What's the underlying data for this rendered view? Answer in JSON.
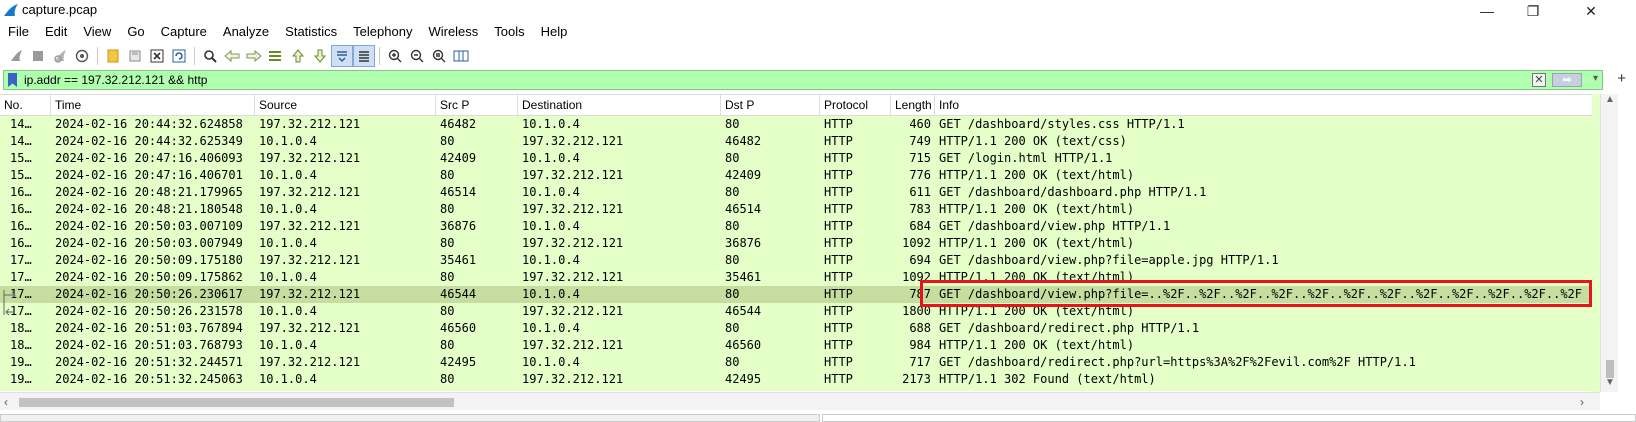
{
  "window": {
    "title": "capture.pcap",
    "min": "—",
    "restore": "❐",
    "close": "✕"
  },
  "menu": [
    "File",
    "Edit",
    "View",
    "Go",
    "Capture",
    "Analyze",
    "Statistics",
    "Telephony",
    "Wireless",
    "Tools",
    "Help"
  ],
  "filter": {
    "value": "ip.addr == 197.32.212.121 && http",
    "clear": "✕",
    "apply": "➡",
    "dropdown": "▾",
    "add": "+"
  },
  "columns": [
    "No.",
    "Time",
    "Source",
    "Src P",
    "Destination",
    "Dst P",
    "Protocol",
    "Length",
    "Info"
  ],
  "packets": [
    {
      "no": "14…",
      "time": "2024-02-16 20:44:32.624858",
      "src": "197.32.212.121",
      "sport": "46482",
      "dst": "10.1.0.4",
      "dport": "80",
      "proto": "HTTP",
      "len": "460",
      "info": "GET /dashboard/styles.css HTTP/1.1"
    },
    {
      "no": "14…",
      "time": "2024-02-16 20:44:32.625349",
      "src": "10.1.0.4",
      "sport": "80",
      "dst": "197.32.212.121",
      "dport": "46482",
      "proto": "HTTP",
      "len": "749",
      "info": "HTTP/1.1 200 OK  (text/css)"
    },
    {
      "no": "15…",
      "time": "2024-02-16 20:47:16.406093",
      "src": "197.32.212.121",
      "sport": "42409",
      "dst": "10.1.0.4",
      "dport": "80",
      "proto": "HTTP",
      "len": "715",
      "info": "GET /login.html HTTP/1.1"
    },
    {
      "no": "15…",
      "time": "2024-02-16 20:47:16.406701",
      "src": "10.1.0.4",
      "sport": "80",
      "dst": "197.32.212.121",
      "dport": "42409",
      "proto": "HTTP",
      "len": "776",
      "info": "HTTP/1.1 200 OK  (text/html)"
    },
    {
      "no": "16…",
      "time": "2024-02-16 20:48:21.179965",
      "src": "197.32.212.121",
      "sport": "46514",
      "dst": "10.1.0.4",
      "dport": "80",
      "proto": "HTTP",
      "len": "611",
      "info": "GET /dashboard/dashboard.php HTTP/1.1"
    },
    {
      "no": "16…",
      "time": "2024-02-16 20:48:21.180548",
      "src": "10.1.0.4",
      "sport": "80",
      "dst": "197.32.212.121",
      "dport": "46514",
      "proto": "HTTP",
      "len": "783",
      "info": "HTTP/1.1 200 OK  (text/html)"
    },
    {
      "no": "16…",
      "time": "2024-02-16 20:50:03.007109",
      "src": "197.32.212.121",
      "sport": "36876",
      "dst": "10.1.0.4",
      "dport": "80",
      "proto": "HTTP",
      "len": "684",
      "info": "GET /dashboard/view.php HTTP/1.1"
    },
    {
      "no": "16…",
      "time": "2024-02-16 20:50:03.007949",
      "src": "10.1.0.4",
      "sport": "80",
      "dst": "197.32.212.121",
      "dport": "36876",
      "proto": "HTTP",
      "len": "1092",
      "info": "HTTP/1.1 200 OK  (text/html)"
    },
    {
      "no": "17…",
      "time": "2024-02-16 20:50:09.175180",
      "src": "197.32.212.121",
      "sport": "35461",
      "dst": "10.1.0.4",
      "dport": "80",
      "proto": "HTTP",
      "len": "694",
      "info": "GET /dashboard/view.php?file=apple.jpg HTTP/1.1"
    },
    {
      "no": "17…",
      "time": "2024-02-16 20:50:09.175862",
      "src": "10.1.0.4",
      "sport": "80",
      "dst": "197.32.212.121",
      "dport": "35461",
      "proto": "HTTP",
      "len": "1092",
      "info": "HTTP/1.1 200 OK  (text/html)"
    },
    {
      "no": "17…",
      "time": "2024-02-16 20:50:26.230617",
      "src": "197.32.212.121",
      "sport": "46544",
      "dst": "10.1.0.4",
      "dport": "80",
      "proto": "HTTP",
      "len": "787",
      "info": "GET /dashboard/view.php?file=..%2F..%2F..%2F..%2F..%2F..%2F..%2F..%2F..%2F..%2F..%2F..%2F",
      "selected": true
    },
    {
      "no": "17…",
      "time": "2024-02-16 20:50:26.231578",
      "src": "10.1.0.4",
      "sport": "80",
      "dst": "197.32.212.121",
      "dport": "46544",
      "proto": "HTTP",
      "len": "1800",
      "info": "HTTP/1.1 200 OK  (text/html)"
    },
    {
      "no": "18…",
      "time": "2024-02-16 20:51:03.767894",
      "src": "197.32.212.121",
      "sport": "46560",
      "dst": "10.1.0.4",
      "dport": "80",
      "proto": "HTTP",
      "len": "688",
      "info": "GET /dashboard/redirect.php HTTP/1.1"
    },
    {
      "no": "18…",
      "time": "2024-02-16 20:51:03.768793",
      "src": "10.1.0.4",
      "sport": "80",
      "dst": "197.32.212.121",
      "dport": "46560",
      "proto": "HTTP",
      "len": "984",
      "info": "HTTP/1.1 200 OK  (text/html)"
    },
    {
      "no": "19…",
      "time": "2024-02-16 20:51:32.244571",
      "src": "197.32.212.121",
      "sport": "42495",
      "dst": "10.1.0.4",
      "dport": "80",
      "proto": "HTTP",
      "len": "717",
      "info": "GET /dashboard/redirect.php?url=https%3A%2F%2Fevil.com%2F HTTP/1.1"
    },
    {
      "no": "19…",
      "time": "2024-02-16 20:51:32.245063",
      "src": "10.1.0.4",
      "sport": "80",
      "dst": "197.32.212.121",
      "dport": "42495",
      "proto": "HTTP",
      "len": "2173",
      "info": "HTTP/1.1 302 Found  (text/html)"
    }
  ],
  "colors": {
    "row_bg": "#e4ffc7",
    "selected_row": "#c5dea0",
    "filter_bg": "#afffaf",
    "highlight_box": "#e8141c"
  },
  "icons": [
    "wireshark-fin-icon",
    "start-capture-icon",
    "stop-capture-icon",
    "restart-capture-icon",
    "capture-options-icon",
    "open-file-icon",
    "save-file-icon",
    "close-file-icon",
    "reload-file-icon",
    "find-packet-icon",
    "go-back-icon",
    "go-forward-icon",
    "go-to-packet-icon",
    "first-packet-icon",
    "last-packet-icon",
    "auto-scroll-icon",
    "colorize-icon",
    "zoom-in-icon",
    "zoom-out-icon",
    "zoom-reset-icon",
    "resize-columns-icon"
  ]
}
